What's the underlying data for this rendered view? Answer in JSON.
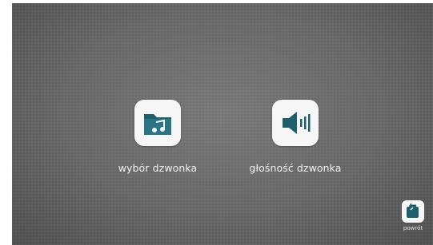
{
  "menu": {
    "items": [
      {
        "label": "wybór dzwonka",
        "icon": "music-folder-icon"
      },
      {
        "label": "głośność dzwonka",
        "icon": "speaker-volume-icon"
      }
    ]
  },
  "footer": {
    "back_label": "powrót",
    "back_icon": "back-arrow-icon"
  },
  "colors": {
    "accent": "#1e5f6e",
    "tile_bg": "#f6f6f6",
    "screen_bg": "#686868",
    "label_text": "#f2f2f2"
  }
}
